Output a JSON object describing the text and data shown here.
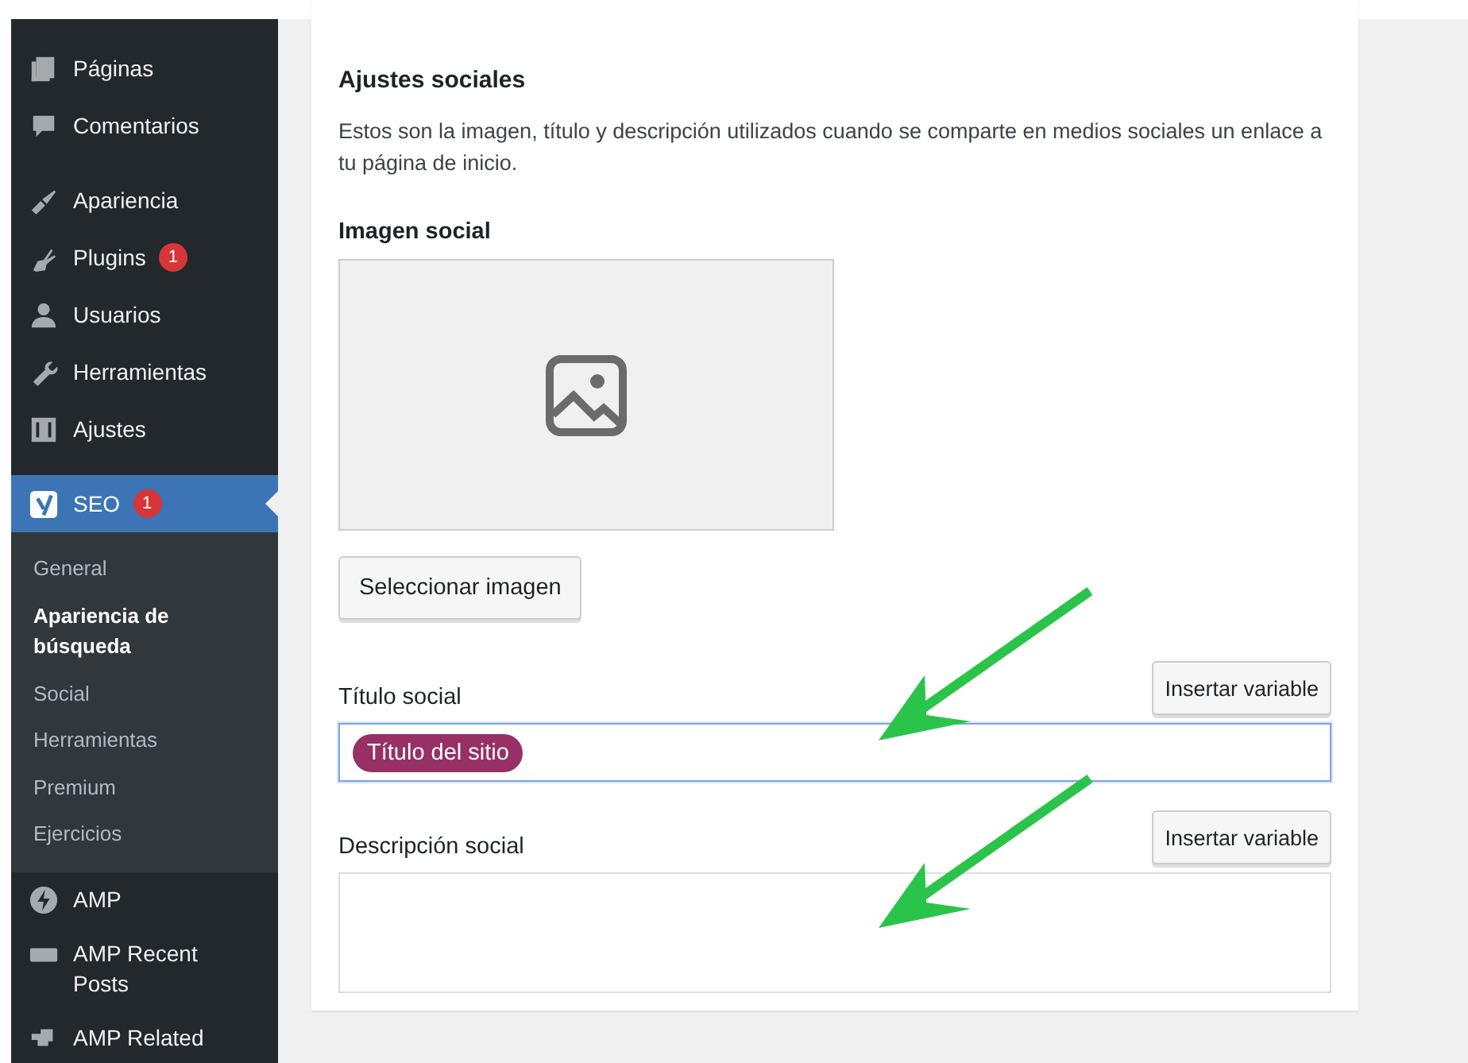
{
  "sidebar": {
    "items": [
      {
        "label": "Páginas",
        "selected": false
      },
      {
        "label": "Comentarios",
        "selected": false
      },
      {
        "label": "Apariencia",
        "selected": false
      },
      {
        "label": "Plugins",
        "badge": "1",
        "selected": false
      },
      {
        "label": "Usuarios",
        "selected": false
      },
      {
        "label": "Herramientas",
        "selected": false
      },
      {
        "label": "Ajustes",
        "selected": false
      },
      {
        "label": "SEO",
        "badge": "1",
        "selected": true,
        "children": [
          {
            "label": "General",
            "selected": false
          },
          {
            "label": "Apariencia de búsqueda",
            "selected": true
          },
          {
            "label": "Social",
            "selected": false
          },
          {
            "label": "Herramientas",
            "selected": false
          },
          {
            "label": "Premium",
            "selected": false
          },
          {
            "label": "Ejercicios",
            "selected": false
          }
        ]
      },
      {
        "label": "AMP",
        "selected": false
      },
      {
        "label": "AMP Recent Posts",
        "selected": false
      },
      {
        "label": "AMP Related",
        "selected": false
      }
    ]
  },
  "section": {
    "title": "Ajustes sociales",
    "description": "Estos son la imagen, título y descripción utilizados cuando se comparte en medios sociales un enlace a tu página de inicio.",
    "image": {
      "label": "Imagen social",
      "button": "Seleccionar imagen"
    },
    "title_field": {
      "label": "Título social",
      "button": "Insertar variable",
      "variable": "Título del sitio"
    },
    "description_field": {
      "label": "Descripción social",
      "button": "Insertar variable"
    }
  }
}
